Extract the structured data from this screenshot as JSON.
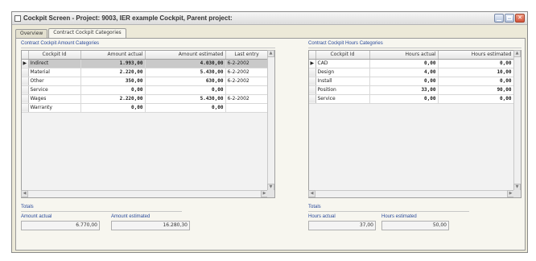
{
  "window": {
    "title": "Cockpit Screen - Project: 9003, IER example Cockpit, Parent project:"
  },
  "tabs": [
    {
      "label": "Overview"
    },
    {
      "label": "Contract Cockpit Categories"
    }
  ],
  "amount_section": {
    "title": "Contract Cockpit Amount Categories",
    "columns": [
      "Cockpit Id",
      "Amount actual",
      "Amount estimated",
      "Last entry"
    ],
    "rows": [
      {
        "id": "Indirect",
        "actual": "1.993,00",
        "estimated": "4.030,00",
        "last": "6-2-2002"
      },
      {
        "id": "Material",
        "actual": "2.220,00",
        "estimated": "5.430,00",
        "last": "6-2-2002"
      },
      {
        "id": "Other",
        "actual": "350,00",
        "estimated": "630,00",
        "last": "6-2-2002"
      },
      {
        "id": "Service",
        "actual": "0,00",
        "estimated": "0,00",
        "last": ""
      },
      {
        "id": "Wages",
        "actual": "2.220,00",
        "estimated": "5.430,00",
        "last": "6-2-2002"
      },
      {
        "id": "Warranty",
        "actual": "0,00",
        "estimated": "0,00",
        "last": ""
      }
    ]
  },
  "hours_section": {
    "title": "Contract Cockpit Hours Categories",
    "columns": [
      "Cockpit Id",
      "Hours actual",
      "Hours estimated"
    ],
    "rows": [
      {
        "id": "CAD",
        "actual": "0,00",
        "estimated": "0,00"
      },
      {
        "id": "Design",
        "actual": "4,00",
        "estimated": "10,00"
      },
      {
        "id": "Install",
        "actual": "0,00",
        "estimated": "0,00"
      },
      {
        "id": "Position",
        "actual": "33,00",
        "estimated": "90,00"
      },
      {
        "id": "Service",
        "actual": "0,00",
        "estimated": "0,00"
      }
    ]
  },
  "amount_totals": {
    "title": "Totals",
    "actual_label": "Amount actual",
    "actual_value": "6.770,00",
    "estimated_label": "Amount estimated",
    "estimated_value": "16.280,30"
  },
  "hours_totals": {
    "title": "Totals",
    "actual_label": "Hours actual",
    "actual_value": "37,00",
    "estimated_label": "Hours estimated",
    "estimated_value": "50,00"
  },
  "icons": {
    "selected_row": "▶"
  }
}
